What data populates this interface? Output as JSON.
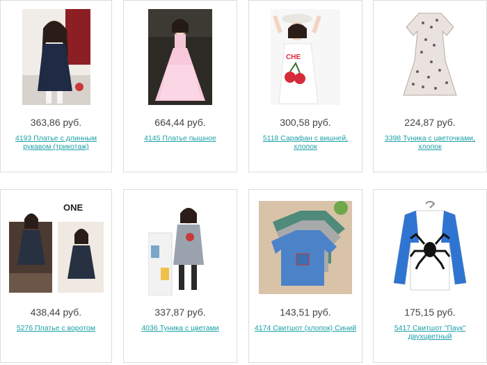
{
  "products": [
    {
      "price": "363,86 руб.",
      "title": "4193 Платье с длинным рукавом (трикотаж)",
      "image": "girl in navy long-sleeve dress"
    },
    {
      "price": "664,44 руб.",
      "title": "4145 Платье пышное",
      "image": "girl in pink tulle dress"
    },
    {
      "price": "300,58 руб.",
      "title": "5118 Сарафан с вишней, хлопок",
      "image": "girl in white dress with cherry print"
    },
    {
      "price": "224,87 руб.",
      "title": "3398 Туника с цветочками, хлопок",
      "image": "floral print tunic"
    },
    {
      "price": "438,44 руб.",
      "title": "5276 Платье с воротом",
      "image": "two girls in navy dresses",
      "overlay_text": "ONE"
    },
    {
      "price": "337,87 руб.",
      "title": "4036 Туника с цветами",
      "image": "girl in grey tunic with flower"
    },
    {
      "price": "143,51 руб.",
      "title": "4174 Свитшот (хлопок) Синий",
      "image": "stack of kids sweatshirts"
    },
    {
      "price": "175,15 руб.",
      "title": "5417 Свитшот \"Паук\" двухцветный",
      "image": "white and blue raglan sweatshirt with spider"
    }
  ],
  "colors": {
    "link": "#1a9fa6",
    "price": "#444444",
    "border": "#dcdcdc"
  }
}
